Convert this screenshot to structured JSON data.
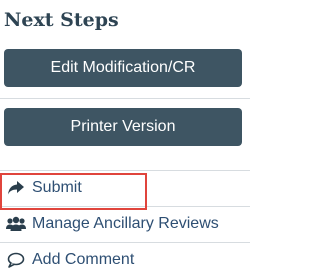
{
  "panel": {
    "title": "Next Steps"
  },
  "buttons": {
    "edit_label": "Edit Modification/CR",
    "printer_label": "Printer Version"
  },
  "links": [
    {
      "label": "Submit",
      "icon": "share-arrow-icon"
    },
    {
      "label": "Manage Ancillary Reviews",
      "icon": "users-group-icon"
    },
    {
      "label": "Add Comment",
      "icon": "comment-bubble-icon"
    }
  ],
  "colors": {
    "button_bg": "#3e5563",
    "link_text": "#2e4f73",
    "title_text": "#2e4453",
    "highlight": "#e0443c"
  }
}
